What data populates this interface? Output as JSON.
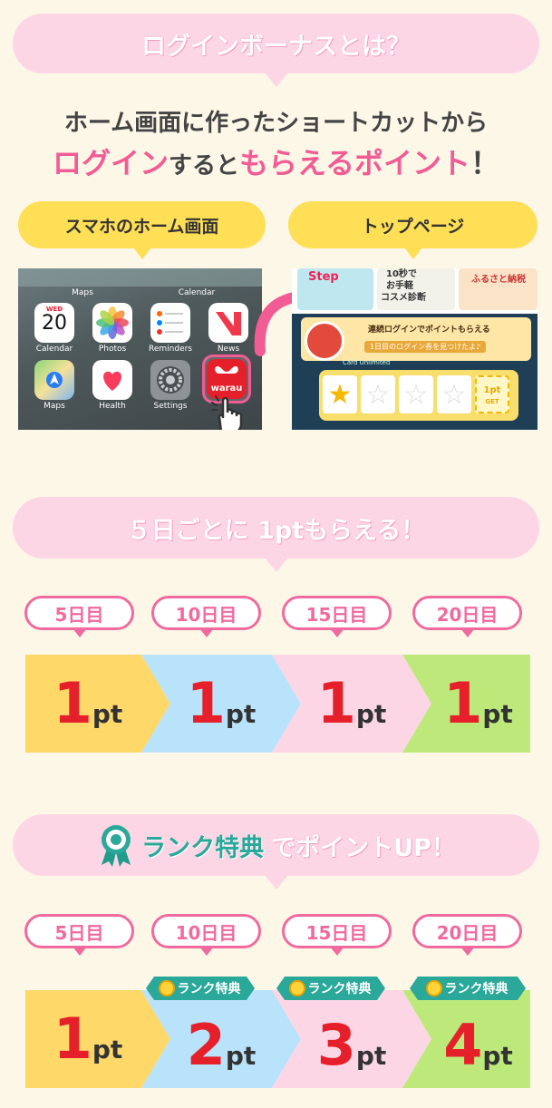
{
  "section1": {
    "title": "ログインボーナスとは？",
    "line1": "ホーム画面に作ったショートカットから",
    "line2_a": "ログイン",
    "line2_b": "すると",
    "line2_c": "もらえるポイント",
    "line2_d": "！",
    "left_label": "スマホのホーム画面",
    "right_label": "トップページ",
    "home_screen": {
      "top_labels": [
        "Maps",
        "Calendar"
      ],
      "calendar_day": "WED",
      "calendar_date": "20",
      "apps_row1": [
        "Calendar",
        "Photos",
        "Reminders",
        "News"
      ],
      "apps_row2": [
        "Maps",
        "Health",
        "Settings"
      ],
      "shortcut_text": "warau"
    },
    "top_page": {
      "banner1": "Step",
      "banner2_line1": "10秒で",
      "banner2_line2": "お手軽",
      "banner2_line3": "コスメ診断",
      "banner3": "ふるさと納税",
      "ribbon1": "連続ログインでポイントもらえる",
      "ribbon2": "1日目のログイン券を見つけたよ♪",
      "card_label": "Card Unlimited",
      "get_line1": "1pt",
      "get_line2": "GET"
    }
  },
  "section2": {
    "title": "５日ごとに 1ptもらえる！",
    "days": [
      "5日目",
      "10日目",
      "15日目",
      "20日目"
    ],
    "points": [
      "1",
      "1",
      "1",
      "1"
    ],
    "unit": "pt"
  },
  "section3": {
    "title_a": "ランク特典",
    "title_b": "でポイントUP！",
    "days": [
      "5日目",
      "10日目",
      "15日目",
      "20日目"
    ],
    "rank_tag": "ランク特典",
    "points": [
      "1",
      "2",
      "3",
      "4"
    ],
    "unit": "pt"
  },
  "colors": {
    "pink": "#f25c94",
    "pink_light": "#fdd6e6",
    "yellow": "#ffdf55",
    "blue": "#b9e3fb",
    "green": "#bde97a",
    "red": "#e6202a",
    "teal": "#2aa89a",
    "background": "#fdf7e8"
  }
}
